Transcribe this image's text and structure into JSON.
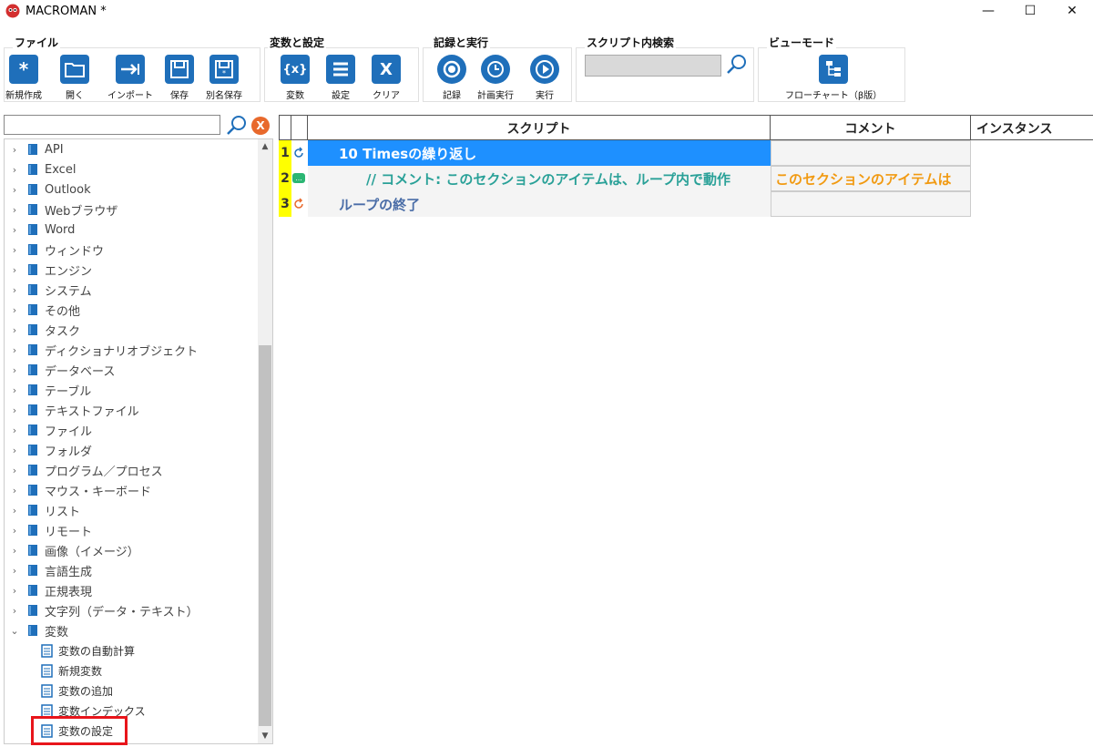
{
  "window": {
    "title": "MACROMAN *",
    "minimize": "—",
    "maximize": "☐",
    "close": "✕"
  },
  "ribbon": {
    "file_group": {
      "title": "ファイル",
      "new": "新規作成",
      "open": "開く",
      "import": "インポート",
      "save": "保存",
      "save_as": "別名保存"
    },
    "vars_group": {
      "title": "変数と設定",
      "vars": "変数",
      "settings": "設定",
      "clear": "クリア",
      "vars_icon": "{x}",
      "clear_icon": "X"
    },
    "record_group": {
      "title": "記録と実行",
      "record": "記録",
      "schedule": "計画実行",
      "run": "実行"
    },
    "search_group": {
      "title": "スクリプト内検索",
      "value": ""
    },
    "view_group": {
      "title": "ビューモード",
      "flowchart": "フローチャート（β版）"
    }
  },
  "left_panel": {
    "search_value": "",
    "clear_icon": "X",
    "categories": [
      "API",
      "Excel",
      "Outlook",
      "Webブラウザ",
      "Word",
      "ウィンドウ",
      "エンジン",
      "システム",
      "その他",
      "タスク",
      "ディクショナリオブジェクト",
      "データベース",
      "テーブル",
      "テキストファイル",
      "ファイル",
      "フォルダ",
      "プログラム／プロセス",
      "マウス・キーボード",
      "リスト",
      "リモート",
      "画像（イメージ）",
      "言語生成",
      "正規表現",
      "文字列（データ・テキスト）",
      "変数"
    ],
    "expanded_children": [
      "変数の自動計算",
      "新規変数",
      "変数の追加",
      "変数インデックス",
      "変数の設定"
    ],
    "selected_child": "変数の設定"
  },
  "grid": {
    "headers": {
      "script": "スクリプト",
      "comment": "コメント",
      "instance": "インスタンス"
    },
    "rows": [
      {
        "num": "1",
        "script": "10 Timesの繰り返し",
        "comment": "",
        "icon": "loop-icon",
        "selected": true
      },
      {
        "num": "2",
        "script": "// コメント: このセクションのアイテムは、ループ内で動作",
        "comment": "このセクションのアイテムは",
        "icon": "comment-icon",
        "selected": false
      },
      {
        "num": "3",
        "script": "ループの終了",
        "comment": "",
        "icon": "loop-end-icon",
        "selected": false
      }
    ]
  },
  "colors": {
    "accent": "#1f6fba",
    "selection": "#1e90ff",
    "comment_text": "#f19a12",
    "comment_script": "#2aa198",
    "row_number_bg": "#ffff00",
    "highlight_box": "#e8151b"
  }
}
